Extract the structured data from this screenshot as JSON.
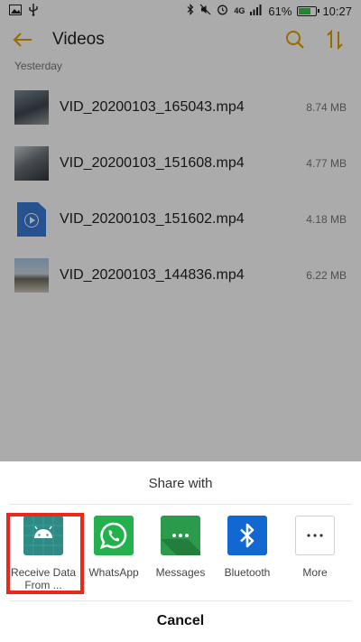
{
  "status_bar": {
    "battery": "61%",
    "time": "10:27",
    "network": "4G"
  },
  "app_bar": {
    "title": "Videos"
  },
  "section_header": "Yesterday",
  "files": [
    {
      "name": "VID_20200103_165043.mp4",
      "size": "8.74 MB"
    },
    {
      "name": "VID_20200103_151608.mp4",
      "size": "4.77 MB"
    },
    {
      "name": "VID_20200103_151602.mp4",
      "size": "4.18 MB"
    },
    {
      "name": "VID_20200103_144836.mp4",
      "size": "6.22 MB"
    }
  ],
  "share_sheet": {
    "title": "Share with",
    "targets": [
      {
        "label": "Receive Data From ...",
        "icon": "android-app-icon",
        "highlighted": true
      },
      {
        "label": "WhatsApp",
        "icon": "whatsapp-icon"
      },
      {
        "label": "Messages",
        "icon": "messages-icon"
      },
      {
        "label": "Bluetooth",
        "icon": "bluetooth-icon"
      },
      {
        "label": "More",
        "icon": "more-icon"
      }
    ],
    "cancel_label": "Cancel"
  },
  "colors": {
    "accent": "#e0a100",
    "highlight_box": "#e8281c",
    "battery_fill": "#2ecc40"
  }
}
